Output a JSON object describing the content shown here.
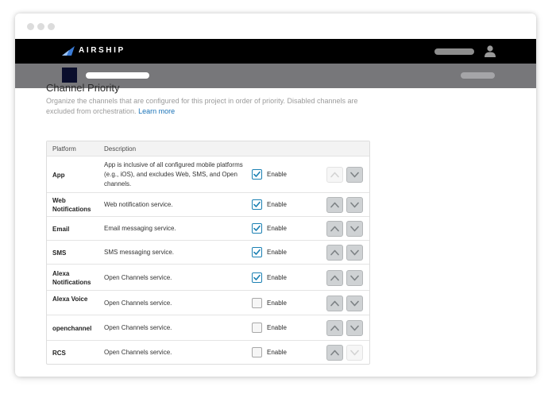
{
  "app": {
    "brand": "AIRSHIP"
  },
  "page": {
    "title": "Channel Priority",
    "description": "Organize the channels that are configured for this project in order of priority. Disabled channels are excluded from orchestration.",
    "learn_more": "Learn more"
  },
  "table": {
    "headers": {
      "platform": "Platform",
      "description": "Description"
    },
    "rows": [
      {
        "platform": "App",
        "description": "App is inclusive of all configured mobile platforms (e.g., iOS), and excludes Web, SMS, and Open channels.",
        "enabled": true,
        "enable_label": "Enable",
        "up_disabled": true,
        "down_disabled": false
      },
      {
        "platform": "Web Notifications",
        "description": "Web notification service.",
        "enabled": true,
        "enable_label": "Enable",
        "up_disabled": false,
        "down_disabled": false
      },
      {
        "platform": "Email",
        "description": "Email messaging service.",
        "enabled": true,
        "enable_label": "Enable",
        "up_disabled": false,
        "down_disabled": false
      },
      {
        "platform": "SMS",
        "description": "SMS messaging service.",
        "enabled": true,
        "enable_label": "Enable",
        "up_disabled": false,
        "down_disabled": false
      },
      {
        "platform": "Alexa Notifications",
        "description": "Open Channels service.",
        "enabled": true,
        "enable_label": "Enable",
        "up_disabled": false,
        "down_disabled": false
      },
      {
        "platform": "Alexa Voice",
        "description": "Open Channels service.",
        "enabled": false,
        "enable_label": "Enable",
        "up_disabled": false,
        "down_disabled": false
      },
      {
        "platform": "openchannel",
        "description": "Open Channels service.",
        "enabled": false,
        "enable_label": "Enable",
        "up_disabled": false,
        "down_disabled": false
      },
      {
        "platform": "RCS",
        "description": "Open Channels service.",
        "enabled": false,
        "enable_label": "Enable",
        "up_disabled": false,
        "down_disabled": true
      }
    ]
  },
  "icons": {
    "logo": "airship-logo-icon",
    "user": "user-icon",
    "check": "checkmark-icon",
    "up": "chevron-up-icon",
    "down": "chevron-down-icon"
  },
  "colors": {
    "topbar": "#000000",
    "subbar": "#77777a",
    "accent": "#1b80b3",
    "link": "#1a73b8"
  }
}
